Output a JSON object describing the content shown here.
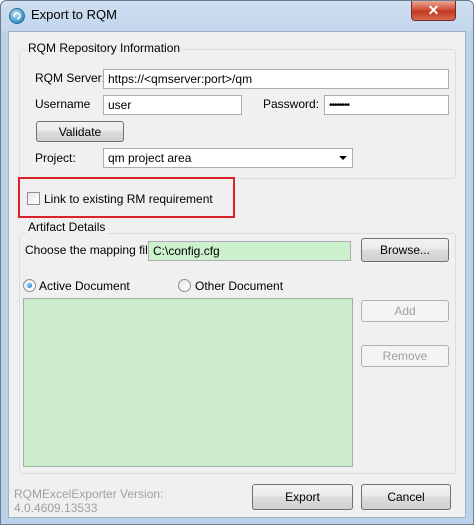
{
  "window": {
    "title": "Export to RQM",
    "close_symbol": "✕"
  },
  "repository": {
    "group_title": "RQM Repository Information",
    "server_label": "RQM Server:",
    "server_value": "https://<qmserver:port>/qm",
    "username_label": "Username",
    "username_value": "user",
    "password_label": "Password:",
    "password_value": "••••••••",
    "validate_label": "Validate",
    "project_label": "Project:",
    "project_value": "qm project area"
  },
  "link_checkbox": {
    "label": "Link to existing RM requirement",
    "checked": false
  },
  "artifact": {
    "group_title": "Artifact Details",
    "mapping_label": "Choose the mapping file:",
    "mapping_value": "C:\\config.cfg",
    "browse_label": "Browse...",
    "active_doc_label": "Active Document",
    "other_doc_label": "Other Document",
    "selected": "active",
    "add_label": "Add",
    "remove_label": "Remove"
  },
  "footer": {
    "version_line1": "RQMExcelExporter Version:",
    "version_line2": "4.0.4609.13533",
    "export_label": "Export",
    "cancel_label": "Cancel"
  },
  "colors": {
    "list_background": "#ccebcc",
    "mapping_field_background": "#cdf0cd",
    "highlight": "#d8232a"
  },
  "icons": [
    "app-icon",
    "close-icon",
    "chevron-down-icon"
  ]
}
